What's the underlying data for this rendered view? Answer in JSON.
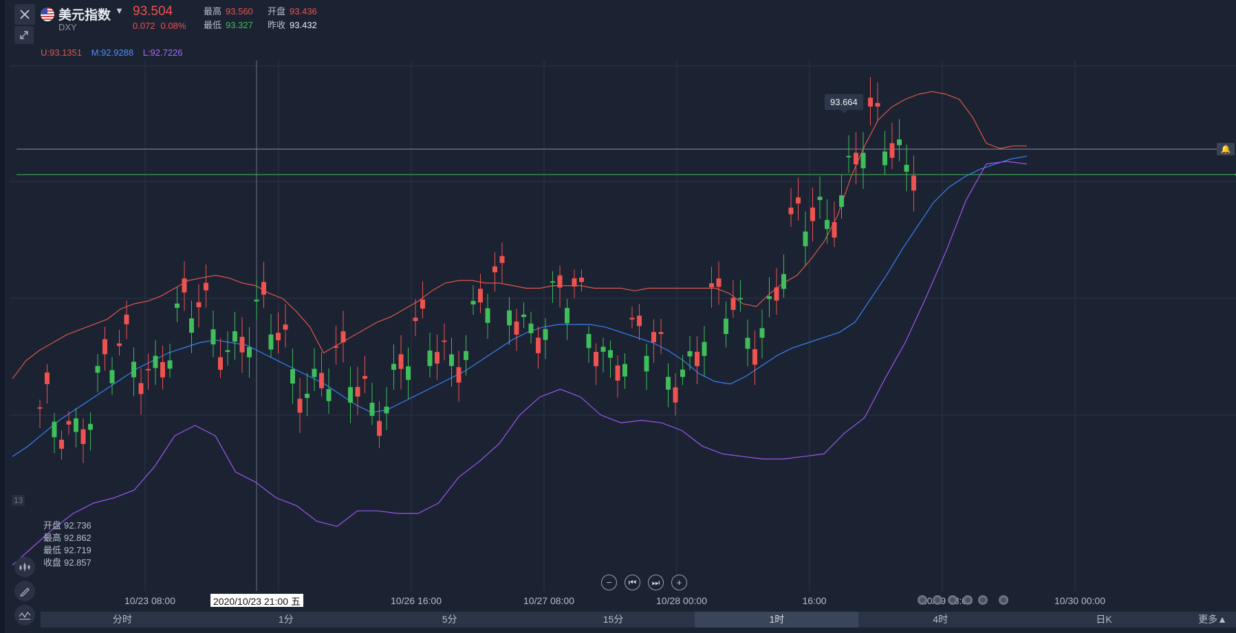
{
  "instrument": {
    "name": "美元指数",
    "code": "DXY",
    "price": "93.504",
    "change": "0.072",
    "change_pct": "0.08%"
  },
  "stats": {
    "high_label": "最高",
    "high": "93.560",
    "open_label": "开盘",
    "open": "93.436",
    "low_label": "最低",
    "low": "93.327",
    "prev_close_label": "昨收",
    "prev_close": "93.432"
  },
  "indicator": {
    "upper": "U:93.1351",
    "middle": "M:92.9288",
    "lower": "L:92.7226"
  },
  "tooltip_high": "93.664",
  "y_left_label": "13",
  "ohlc_readout": {
    "open_label": "开盘",
    "open": "92.736",
    "high_label": "最高",
    "high": "92.862",
    "low_label": "最低",
    "low": "92.719",
    "close_label": "收盘",
    "close": "92.857"
  },
  "crosshair_time": "2020/10/23 21:00 五",
  "x_ticks": [
    "10/23 08:00",
    "10/26 16:00",
    "10/27 08:00",
    "10/28 00:00",
    "16:00",
    "10/29 08:00",
    "10/30 00:00"
  ],
  "nav_buttons": {
    "zoom_out": "−",
    "first": "⏮",
    "last": "⏭",
    "zoom_in": "+"
  },
  "timeframes": [
    "分时",
    "1分",
    "5分",
    "15分",
    "1时",
    "4时",
    "日K"
  ],
  "active_timeframe": "1时",
  "more_label": "更多▲",
  "icons": {
    "close": "close-icon",
    "expand": "expand-icon",
    "candles": "candlestick-icon",
    "draw": "pencil-icon",
    "indicator": "indicator-icon",
    "bell": "bell-icon"
  },
  "colors": {
    "up": "#ef5350",
    "down": "#3fbe5a",
    "upper_band": "#e0584a",
    "middle_band": "#3b82f6",
    "lower_band": "#9b59f0",
    "background": "#1b2232"
  },
  "chart_data": {
    "type": "candlestick",
    "series": [
      {
        "name": "U:93.1351",
        "values": [
          92.72,
          92.79,
          92.83,
          92.86,
          92.89,
          92.91,
          92.93,
          92.95,
          92.99,
          93.01,
          93.02,
          93.04,
          93.07,
          93.1,
          93.11,
          93.12,
          93.11,
          93.09,
          93.08,
          93.05,
          93.03,
          92.98,
          92.92,
          92.82,
          92.85,
          92.88,
          92.91,
          92.94,
          92.96,
          92.99,
          93.02,
          93.06,
          93.09,
          93.1,
          93.1,
          93.09,
          93.09,
          93.08,
          93.07,
          93.07,
          93.08,
          93.08,
          93.08,
          93.07,
          93.07,
          93.07,
          93.06,
          93.07,
          93.07,
          93.07,
          93.07,
          93.07,
          93.07,
          93.05,
          93.01,
          93.0,
          93.05,
          93.09,
          93.12,
          93.18,
          93.25,
          93.35,
          93.5,
          93.62,
          93.72,
          93.77,
          93.8,
          93.82,
          93.83,
          93.82,
          93.8,
          93.73,
          93.63,
          93.61,
          93.62,
          93.62
        ]
      },
      {
        "name": "M:92.9288",
        "values": [
          92.42,
          92.46,
          92.51,
          92.56,
          92.6,
          92.64,
          92.68,
          92.72,
          92.76,
          92.79,
          92.82,
          92.84,
          92.86,
          92.87,
          92.86,
          92.85,
          92.82,
          92.79,
          92.76,
          92.73,
          92.7,
          92.66,
          92.62,
          92.59,
          92.6,
          92.63,
          92.66,
          92.69,
          92.72,
          92.75,
          92.79,
          92.83,
          92.87,
          92.9,
          92.92,
          92.93,
          92.93,
          92.93,
          92.92,
          92.9,
          92.88,
          92.86,
          92.83,
          92.79,
          92.74,
          92.71,
          92.7,
          92.73,
          92.77,
          92.81,
          92.84,
          92.86,
          92.88,
          92.9,
          92.94,
          93.03,
          93.12,
          93.22,
          93.31,
          93.4,
          93.46,
          93.5,
          93.53,
          93.55,
          93.57,
          93.58
        ]
      },
      {
        "name": "L:92.7226",
        "values": [
          92.0,
          92.07,
          92.14,
          92.2,
          92.24,
          92.26,
          92.29,
          92.38,
          92.5,
          92.54,
          92.5,
          92.36,
          92.32,
          92.26,
          92.23,
          92.17,
          92.15,
          92.21,
          92.21,
          92.2,
          92.2,
          92.24,
          92.34,
          92.4,
          92.47,
          92.58,
          92.65,
          92.68,
          92.65,
          92.58,
          92.55,
          92.56,
          92.55,
          92.52,
          92.46,
          92.43,
          92.42,
          92.41,
          92.41,
          92.42,
          92.43,
          92.51,
          92.57,
          92.72,
          92.86,
          93.03,
          93.21,
          93.41,
          93.55,
          93.56,
          93.55
        ]
      }
    ],
    "high_marker": 93.664
  }
}
